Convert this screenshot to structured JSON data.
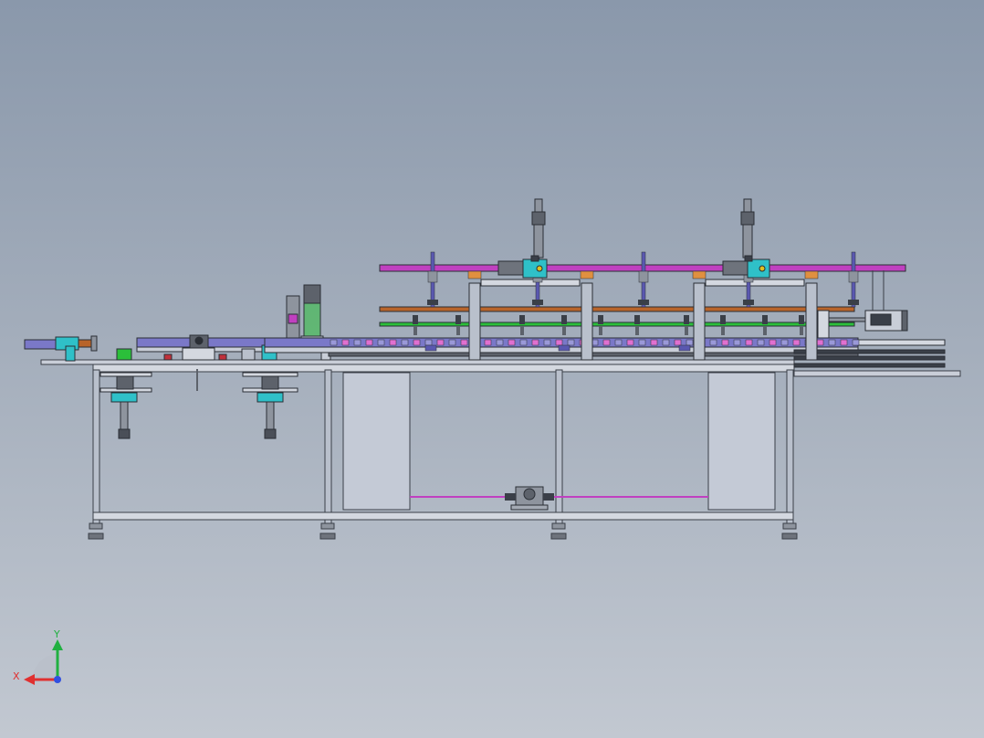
{
  "viewport": {
    "background_top": "#8a98ab",
    "background_bottom": "#c2c8d1"
  },
  "model": {
    "frame_color": "#3a3f48",
    "frame_fill": "#b9c0cc",
    "panel_fill": "#c4cad6",
    "rail_magenta": "#c040c0",
    "rail_green": "#2bbf3a",
    "rail_orange": "#b8642a",
    "conveyor_purple": "#7a78c8",
    "actuator_cyan": "#2fc0c8",
    "motor_gray": "#6e737c"
  },
  "triad": {
    "x_label": "X",
    "y_label": "Y",
    "x_color": "#e03030",
    "y_color": "#20b040",
    "z_color": "#3050e0"
  }
}
